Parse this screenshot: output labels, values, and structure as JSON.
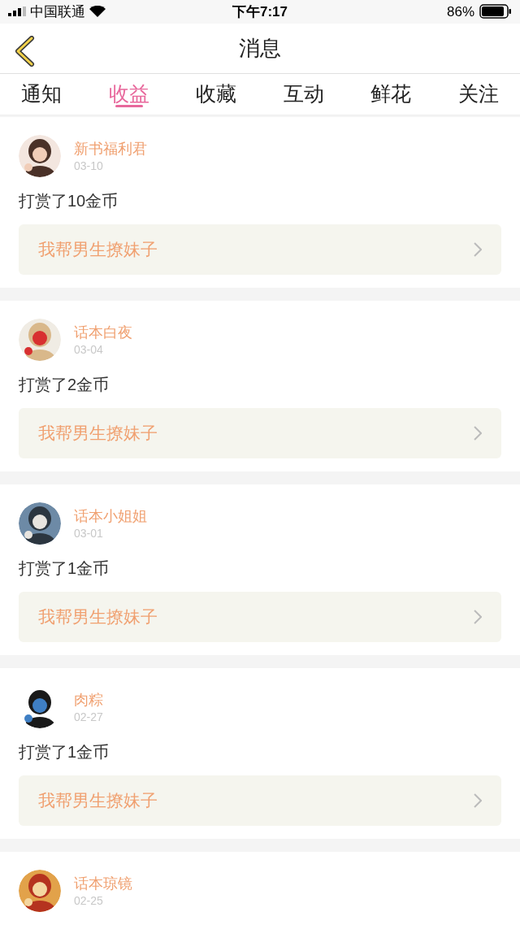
{
  "status_bar": {
    "carrier": "中国联通",
    "time": "下午7:17",
    "battery": "86%"
  },
  "header": {
    "title": "消息"
  },
  "tabs": [
    {
      "label": "通知",
      "selected": false
    },
    {
      "label": "收益",
      "selected": true
    },
    {
      "label": "收藏",
      "selected": false
    },
    {
      "label": "互动",
      "selected": false
    },
    {
      "label": "鲜花",
      "selected": false
    },
    {
      "label": "关注",
      "selected": false
    }
  ],
  "messages": [
    {
      "name": "新书福利君",
      "date": "03-10",
      "text": "打赏了10金币",
      "book": "我帮男生撩妹子"
    },
    {
      "name": "话本白夜",
      "date": "03-04",
      "text": "打赏了2金币",
      "book": "我帮男生撩妹子"
    },
    {
      "name": "话本小姐姐",
      "date": "03-01",
      "text": "打赏了1金币",
      "book": "我帮男生撩妹子"
    },
    {
      "name": "肉粽",
      "date": "02-27",
      "text": "打赏了1金币",
      "book": "我帮男生撩妹子"
    },
    {
      "name": "话本琼镜",
      "date": "02-25"
    }
  ]
}
